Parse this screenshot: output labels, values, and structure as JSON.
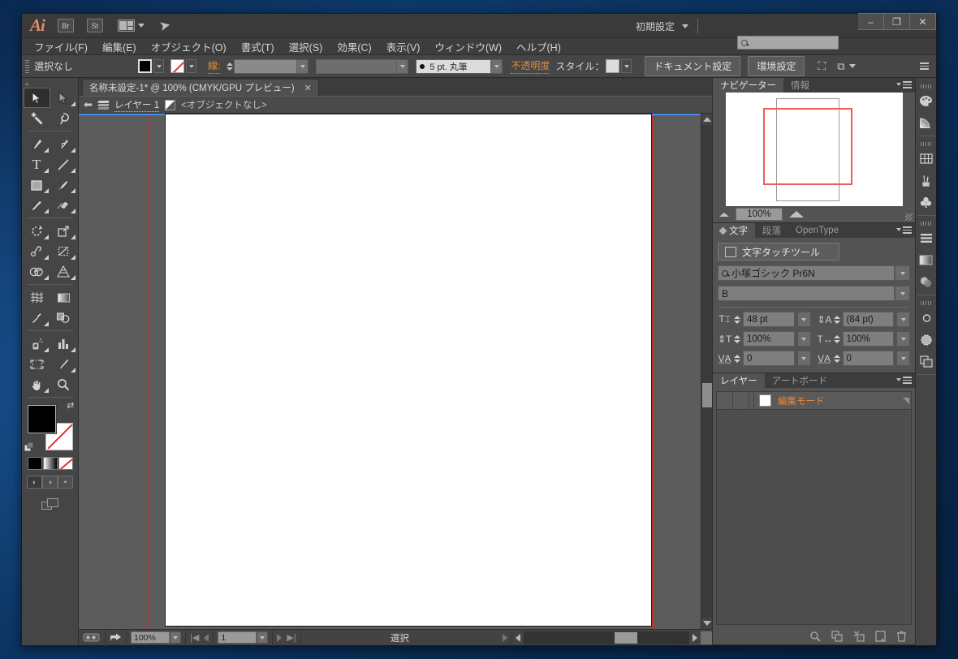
{
  "app": {
    "logo": "Ai",
    "bridge_label": "Br",
    "stock_label": "St",
    "workspace": "初期設定",
    "search_placeholder": "",
    "search_value": "",
    "minimize_label": "–",
    "maximize_label": "❐",
    "close_label": "✕"
  },
  "menu": {
    "items": [
      {
        "label": "ファイル(F)"
      },
      {
        "label": "編集(E)"
      },
      {
        "label": "オブジェクト(O)"
      },
      {
        "label": "書式(T)"
      },
      {
        "label": "選択(S)"
      },
      {
        "label": "効果(C)"
      },
      {
        "label": "表示(V)"
      },
      {
        "label": "ウィンドウ(W)"
      },
      {
        "label": "ヘルプ(H)"
      }
    ]
  },
  "control_bar": {
    "selection_status": "選択なし",
    "stroke_label": "線:",
    "stroke_weight_value": "",
    "stroke_profile_value": "",
    "brush_value": "5 pt. 丸筆",
    "opacity_label": "不透明度",
    "style_label": "スタイル：",
    "document_setup_button": "ドキュメント設定",
    "preferences_button": "環境設定"
  },
  "document": {
    "tab_title": "名称未設定-1* @ 100% (CMYK/GPU プレビュー)",
    "tab_close": "✕"
  },
  "layer_bar": {
    "layer_name": "レイヤー 1",
    "object_status": "<オブジェクトなし>"
  },
  "toolbox": {
    "tools": [
      {
        "name": "selection-tool",
        "glyph": "⬉",
        "active": true
      },
      {
        "name": "direct-selection-tool",
        "glyph": "⬈",
        "active": false
      },
      {
        "name": "magic-wand-tool",
        "glyph": "✳",
        "active": false
      },
      {
        "name": "lasso-tool",
        "glyph": "◠",
        "active": false
      },
      {
        "name": "pen-tool",
        "glyph": "✒",
        "active": false
      },
      {
        "name": "curvature-tool",
        "glyph": "✎",
        "active": false
      },
      {
        "name": "type-tool",
        "glyph": "T",
        "active": false
      },
      {
        "name": "line-segment-tool",
        "glyph": "╱",
        "active": false
      },
      {
        "name": "rectangle-tool",
        "glyph": "▭",
        "active": false
      },
      {
        "name": "paintbrush-tool",
        "glyph": "🖌",
        "active": false
      },
      {
        "name": "pencil-tool",
        "glyph": "✏",
        "active": false
      },
      {
        "name": "eraser-tool",
        "glyph": "▰",
        "active": false
      },
      {
        "name": "rotate-tool",
        "glyph": "↻",
        "active": false
      },
      {
        "name": "scale-tool",
        "glyph": "⤢",
        "active": false
      },
      {
        "name": "width-tool",
        "glyph": "✂",
        "active": false
      },
      {
        "name": "free-transform-tool",
        "glyph": "⛶",
        "active": false
      },
      {
        "name": "shape-builder-tool",
        "glyph": "◑",
        "active": false
      },
      {
        "name": "perspective-grid-tool",
        "glyph": "▦",
        "active": false
      },
      {
        "name": "mesh-tool",
        "glyph": "⌗",
        "active": false
      },
      {
        "name": "gradient-tool",
        "glyph": "▤",
        "active": false
      },
      {
        "name": "eyedropper-tool",
        "glyph": "⚲",
        "active": false
      },
      {
        "name": "blend-tool",
        "glyph": "◎",
        "active": false
      },
      {
        "name": "symbol-sprayer-tool",
        "glyph": "⛁",
        "active": false
      },
      {
        "name": "column-graph-tool",
        "glyph": "▥",
        "active": false
      },
      {
        "name": "artboard-tool",
        "glyph": "⬚",
        "active": false
      },
      {
        "name": "slice-tool",
        "glyph": "🔪",
        "active": false
      },
      {
        "name": "hand-tool",
        "glyph": "✋",
        "active": false
      },
      {
        "name": "zoom-tool",
        "glyph": "⚲",
        "active": false
      }
    ],
    "fill_color": "#000000",
    "stroke_color": "none",
    "mini_swatches": [
      "color",
      "gradient",
      "none"
    ],
    "draw_modes": [
      "draw-normal",
      "draw-behind",
      "draw-inside"
    ]
  },
  "navigator": {
    "tabs": [
      {
        "label": "ナビゲーター",
        "active": true
      },
      {
        "label": "情報",
        "active": false
      }
    ],
    "zoom_value": "100%"
  },
  "character_panel": {
    "tabs": [
      {
        "label": "文字",
        "active": true
      },
      {
        "label": "段落",
        "active": false
      },
      {
        "label": "OpenType",
        "active": false
      }
    ],
    "touch_type_button": "文字タッチツール",
    "font_family": "小塚ゴシック Pr6N",
    "font_style": "B",
    "font_size": "48 pt",
    "leading": "(84 pt)",
    "vertical_scale": "100%",
    "horizontal_scale": "100%",
    "tracking": "0",
    "kerning": "0"
  },
  "layers_panel": {
    "tabs": [
      {
        "label": "レイヤー",
        "active": true
      },
      {
        "label": "アートボード",
        "active": false
      }
    ],
    "rows": [
      {
        "name": "編集モード"
      }
    ],
    "footer_icons": [
      "locate-object-icon",
      "make-sublayer-icon",
      "make-clipping-mask-icon",
      "new-layer-icon",
      "delete-layer-icon"
    ]
  },
  "status_bar": {
    "zoom_value": "100%",
    "page_value": "1",
    "status_text": "選択"
  },
  "icon_rail": {
    "groups": [
      {
        "icons": [
          "color-palette-icon",
          "color-guide-icon"
        ]
      },
      {
        "icons": [
          "swatches-icon",
          "brushes-icon",
          "symbols-icon"
        ]
      },
      {
        "icons": [
          "align-icon",
          "gradient-icon",
          "transparency-icon"
        ]
      },
      {
        "icons": [
          "libraries-icon",
          "appearance-icon",
          "artboards-icon"
        ]
      }
    ]
  },
  "colors": {
    "accent_orange": "#e08a3c",
    "guide_red": "#e02020",
    "selection_blue": "#4d8ef0",
    "panel_bg": "#535353",
    "canvas_gray": "#5c5c5c"
  }
}
